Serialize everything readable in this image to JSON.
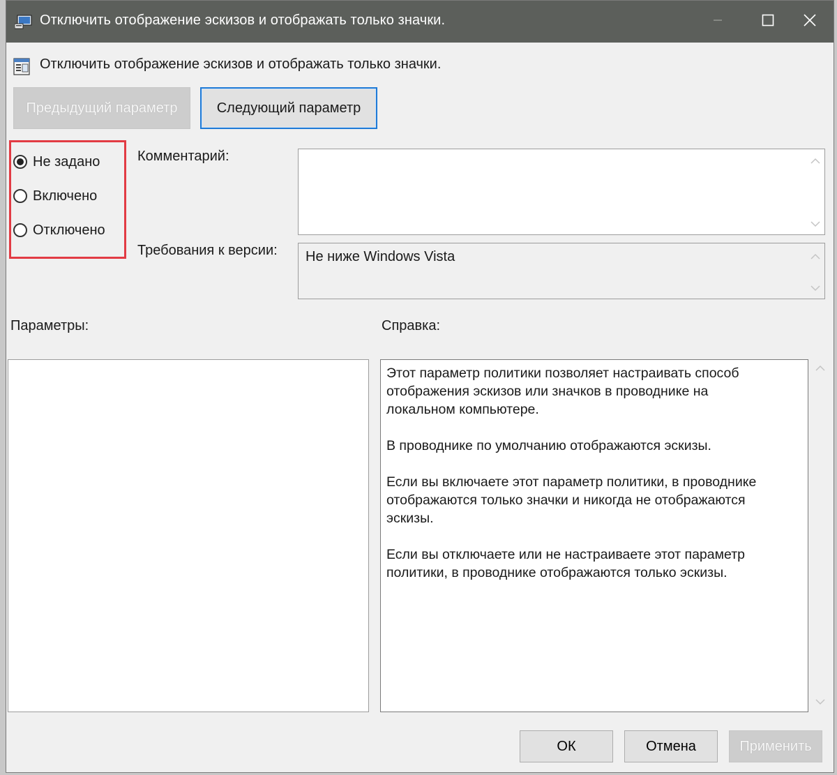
{
  "window": {
    "title": "Отключить отображение эскизов и отображать только значки.",
    "title_icon": "policy-window-icon",
    "controls": {
      "minimize_icon": "minimize-icon",
      "maximize_icon": "maximize-icon",
      "close_icon": "close-icon"
    }
  },
  "policy": {
    "title": "Отключить отображение эскизов и отображать только значки.",
    "icon": "policy-settings-icon"
  },
  "navigation": {
    "prev_label": "Предыдущий параметр",
    "next_label": "Следующий параметр"
  },
  "state_options": {
    "selected": "not_set",
    "items": [
      {
        "id": "not_set",
        "label": "Не задано"
      },
      {
        "id": "enabled",
        "label": "Включено"
      },
      {
        "id": "disabled",
        "label": "Отключено"
      }
    ],
    "highlight_color": "#e23b44"
  },
  "comment": {
    "label": "Комментарий:",
    "value": ""
  },
  "version": {
    "label": "Требования к версии:",
    "value": "Не ниже Windows Vista"
  },
  "options_panel": {
    "label": "Параметры:"
  },
  "help_panel": {
    "label": "Справка:",
    "paragraphs": [
      "Этот параметр политики позволяет настраивать способ\nотображения эскизов или значков в проводнике на\nлокальном компьютере.",
      "В проводнике по умолчанию отображаются эскизы.",
      "Если вы включаете этот параметр политики, в проводнике\nотображаются только значки и никогда не отображаются\nэскизы.",
      "Если вы отключаете или не настраиваете этот параметр\nполитики, в проводнике отображаются только эскизы."
    ]
  },
  "buttons": {
    "ok": "ОК",
    "cancel": "Отмена",
    "apply": "Применить"
  },
  "colors": {
    "titlebar": "#5c5f5b",
    "focus_border": "#1f7ad6",
    "dialog_bg": "#f0f0f0"
  }
}
